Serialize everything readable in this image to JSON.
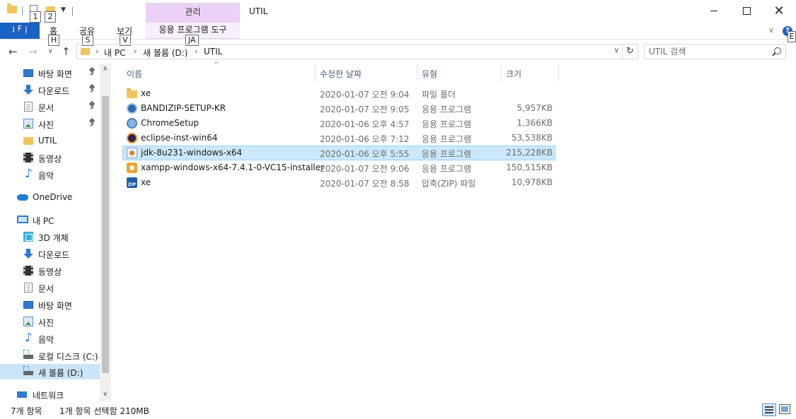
{
  "window": {
    "title": "UTIL",
    "contextual_tab_group": "관리",
    "min_label": "",
    "max_label": "",
    "close_label": "✕"
  },
  "keytips": {
    "qa1": "1",
    "qa2": "2",
    "file": "F",
    "home": "H",
    "share": "S",
    "view": "V",
    "app_tools": "JA",
    "help": "E"
  },
  "ribbon": {
    "file": "파일",
    "home": "홈",
    "share": "공유",
    "view": "보기",
    "app_tools": "응용 프로그램 도구",
    "help_icon": "?"
  },
  "address": {
    "crumbs": [
      "내 PC",
      "새 볼륨 (D:)",
      "UTIL"
    ],
    "search_placeholder": "UTIL 검색"
  },
  "nav_pane": {
    "items": [
      {
        "label": "바탕 화면",
        "icon": "desktop-icon",
        "pinned": true
      },
      {
        "label": "다운로드",
        "icon": "download-icon",
        "pinned": true
      },
      {
        "label": "문서",
        "icon": "document-icon",
        "pinned": true
      },
      {
        "label": "사진",
        "icon": "picture-icon",
        "pinned": true
      },
      {
        "label": "UTIL",
        "icon": "folder-icon"
      },
      {
        "label": "동영상",
        "icon": "video-icon"
      },
      {
        "label": "음악",
        "icon": "music-icon"
      },
      {
        "label": "OneDrive",
        "icon": "onedrive-icon"
      },
      {
        "label": "내 PC",
        "icon": "pc-icon"
      },
      {
        "label": "3D 개체",
        "icon": "3d-objects-icon"
      },
      {
        "label": "다운로드",
        "icon": "download-icon"
      },
      {
        "label": "동영상",
        "icon": "video-icon"
      },
      {
        "label": "문서",
        "icon": "document-icon"
      },
      {
        "label": "바탕 화면",
        "icon": "desktop-icon"
      },
      {
        "label": "사진",
        "icon": "picture-icon"
      },
      {
        "label": "음악",
        "icon": "music-icon"
      },
      {
        "label": "로컬 디스크 (C:)",
        "icon": "drive-icon"
      },
      {
        "label": "새 볼륨 (D:)",
        "icon": "drive-icon",
        "selected": true
      },
      {
        "label": "네트워크",
        "icon": "network-icon"
      }
    ]
  },
  "columns": {
    "name": "이름",
    "date": "수정한 날짜",
    "type": "유형",
    "size": "크기"
  },
  "files": [
    {
      "name": "xe",
      "date": "2020-01-07 오전 9:04",
      "type": "파일 폴더",
      "size": "",
      "icon": "folder-icon"
    },
    {
      "name": "BANDIZIP-SETUP-KR",
      "date": "2020-01-07 오전 9:05",
      "type": "응용 프로그램",
      "size": "5,957KB",
      "icon": "bandizip-icon"
    },
    {
      "name": "ChromeSetup",
      "date": "2020-01-06 오후 4:57",
      "type": "응용 프로그램",
      "size": "1,366KB",
      "icon": "chrome-icon"
    },
    {
      "name": "eclipse-inst-win64",
      "date": "2020-01-06 오후 7:12",
      "type": "응용 프로그램",
      "size": "53,538KB",
      "icon": "eclipse-icon"
    },
    {
      "name": "jdk-8u231-windows-x64",
      "date": "2020-01-06 오후 5:55",
      "type": "응용 프로그램",
      "size": "215,228KB",
      "icon": "java-icon",
      "selected": true
    },
    {
      "name": "xampp-windows-x64-7.4.1-0-VC15-installer",
      "date": "2020-01-07 오전 9:06",
      "type": "응용 프로그램",
      "size": "150,515KB",
      "icon": "xampp-icon"
    },
    {
      "name": "xe",
      "date": "2020-01-07 오전 8:58",
      "type": "압축(ZIP) 파일",
      "size": "10,978KB",
      "icon": "zip-icon"
    }
  ],
  "status": {
    "count": "7개 항목",
    "selection": "1개 항목 선택함 210MB"
  },
  "colors": {
    "accent": "#1a63c6",
    "contextual_tab": "#ead1f5",
    "selection": "#cce8ff"
  }
}
